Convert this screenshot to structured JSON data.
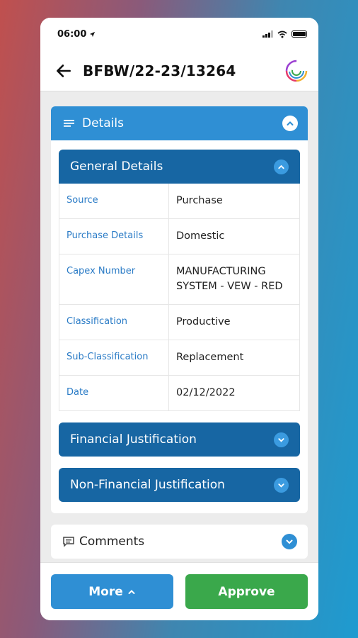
{
  "status": {
    "time": "06:00"
  },
  "header": {
    "title": "BFBW/22-23/13264"
  },
  "details": {
    "label": "Details"
  },
  "general": {
    "label": "General Details",
    "rows": [
      {
        "key": "Source",
        "value": "Purchase"
      },
      {
        "key": "Purchase Details",
        "value": "Domestic"
      },
      {
        "key": "Capex Number",
        "value": "MANUFACTURING SYSTEM - VEW - RED"
      },
      {
        "key": "Classification",
        "value": "Productive"
      },
      {
        "key": "Sub-Classification",
        "value": "Replacement"
      },
      {
        "key": "Date",
        "value": "02/12/2022"
      }
    ]
  },
  "financial": {
    "label": "Financial Justification"
  },
  "nonfinancial": {
    "label": "Non-Financial Justification"
  },
  "comments": {
    "label": "Comments"
  },
  "footer": {
    "more_label": "More",
    "approve_label": "Approve"
  },
  "colors": {
    "primary": "#2f8fd4",
    "section": "#1766a3",
    "approve": "#3aa84b"
  }
}
